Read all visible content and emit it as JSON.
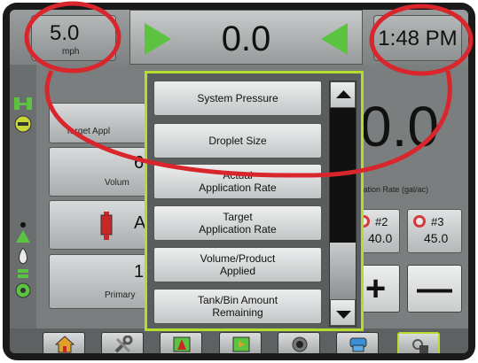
{
  "status_bar": {
    "speed_value": "5.0",
    "speed_unit": "mph",
    "center_value": "0.0",
    "clock": "1:48 PM"
  },
  "widgets": {
    "target_rate_label": "Target Appl",
    "volume_value": "6",
    "volume_label": "Volum",
    "lower_value": "A",
    "primary_value": "1",
    "primary_label": "Primary",
    "actual_rate_big": "0.0",
    "actual_rate_label": "ication Rate (gal/ac)"
  },
  "sections": [
    {
      "name": "#2",
      "value": "40.0"
    },
    {
      "name": "#3",
      "value": "45.0"
    }
  ],
  "controls": {
    "plus_label": "+",
    "minus_label": "—"
  },
  "menu": {
    "items": [
      "System Pressure",
      "Droplet Size",
      "Actual\nApplication Rate",
      "Target\nApplication Rate",
      "Volume/Product\nApplied",
      "Tank/Bin Amount\nRemaining"
    ]
  },
  "toolbar": {
    "buttons": [
      "home-icon",
      "tools-icon",
      "field-icon",
      "guidance-icon",
      "camera-icon",
      "data-icon",
      "lock-icon"
    ]
  },
  "colors": {
    "menu_border": "#b6dd2c",
    "guidance_arrow": "#5cc341",
    "annotation": "#d9262c"
  }
}
